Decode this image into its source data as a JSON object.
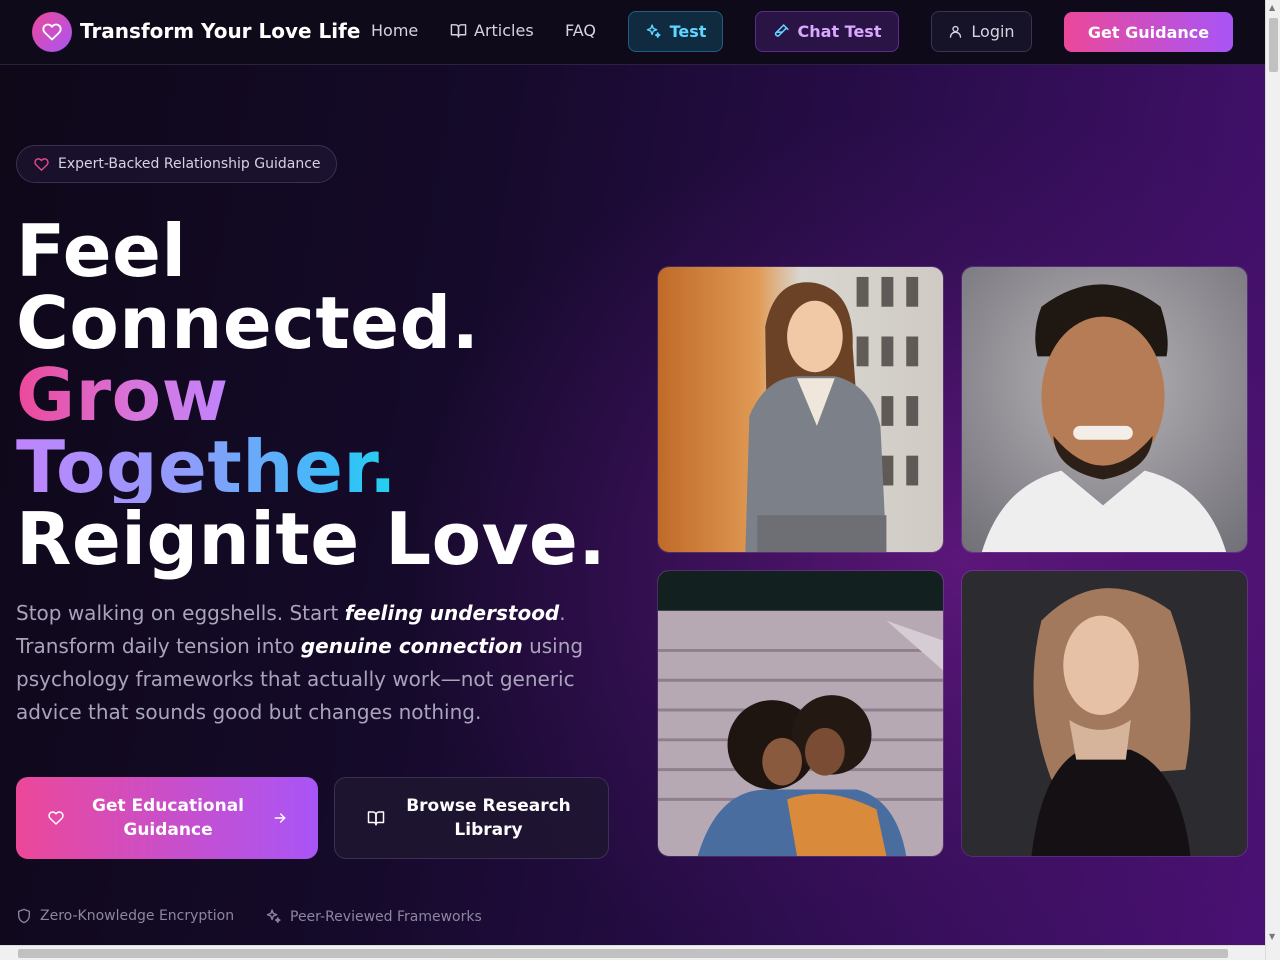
{
  "nav": {
    "brand": "Transform Your Love Life",
    "links": [
      {
        "label": "Home"
      },
      {
        "label": "Articles"
      },
      {
        "label": "FAQ"
      }
    ],
    "test_label": "Test",
    "chat_test_label": "Chat Test",
    "login_label": "Login",
    "guidance_label": "Get Guidance"
  },
  "hero": {
    "badge": "Expert-Backed Relationship Guidance",
    "headline": {
      "line1": "Feel",
      "line2": "Connected.",
      "line3": "Grow",
      "line4": "Together.",
      "line5": "Reignite Love."
    },
    "subtitle": {
      "part1": "Stop walking on eggshells. Start ",
      "em1": "feeling understood",
      "part2": ". Transform daily tension into ",
      "em2": "genuine connection",
      "part3": " using psychology frameworks that actually work—not generic advice that sounds good but changes nothing."
    },
    "cta_primary": "Get Educational Guidance",
    "cta_secondary": "Browse Research Library",
    "trust": [
      {
        "label": "Zero-Knowledge Encryption",
        "icon": "shield-icon"
      },
      {
        "label": "Peer-Reviewed Frameworks",
        "icon": "sparkles-icon"
      }
    ]
  },
  "photos": [
    {
      "name": "photo-woman-blazer"
    },
    {
      "name": "photo-smiling-man"
    },
    {
      "name": "photo-couple-embrace"
    },
    {
      "name": "photo-woman-portrait"
    }
  ],
  "colors": {
    "accent_pink": "#ec4899",
    "accent_purple": "#a855f7",
    "accent_cyan": "#22d3ee",
    "nav_bg": "#0e0a1a"
  }
}
